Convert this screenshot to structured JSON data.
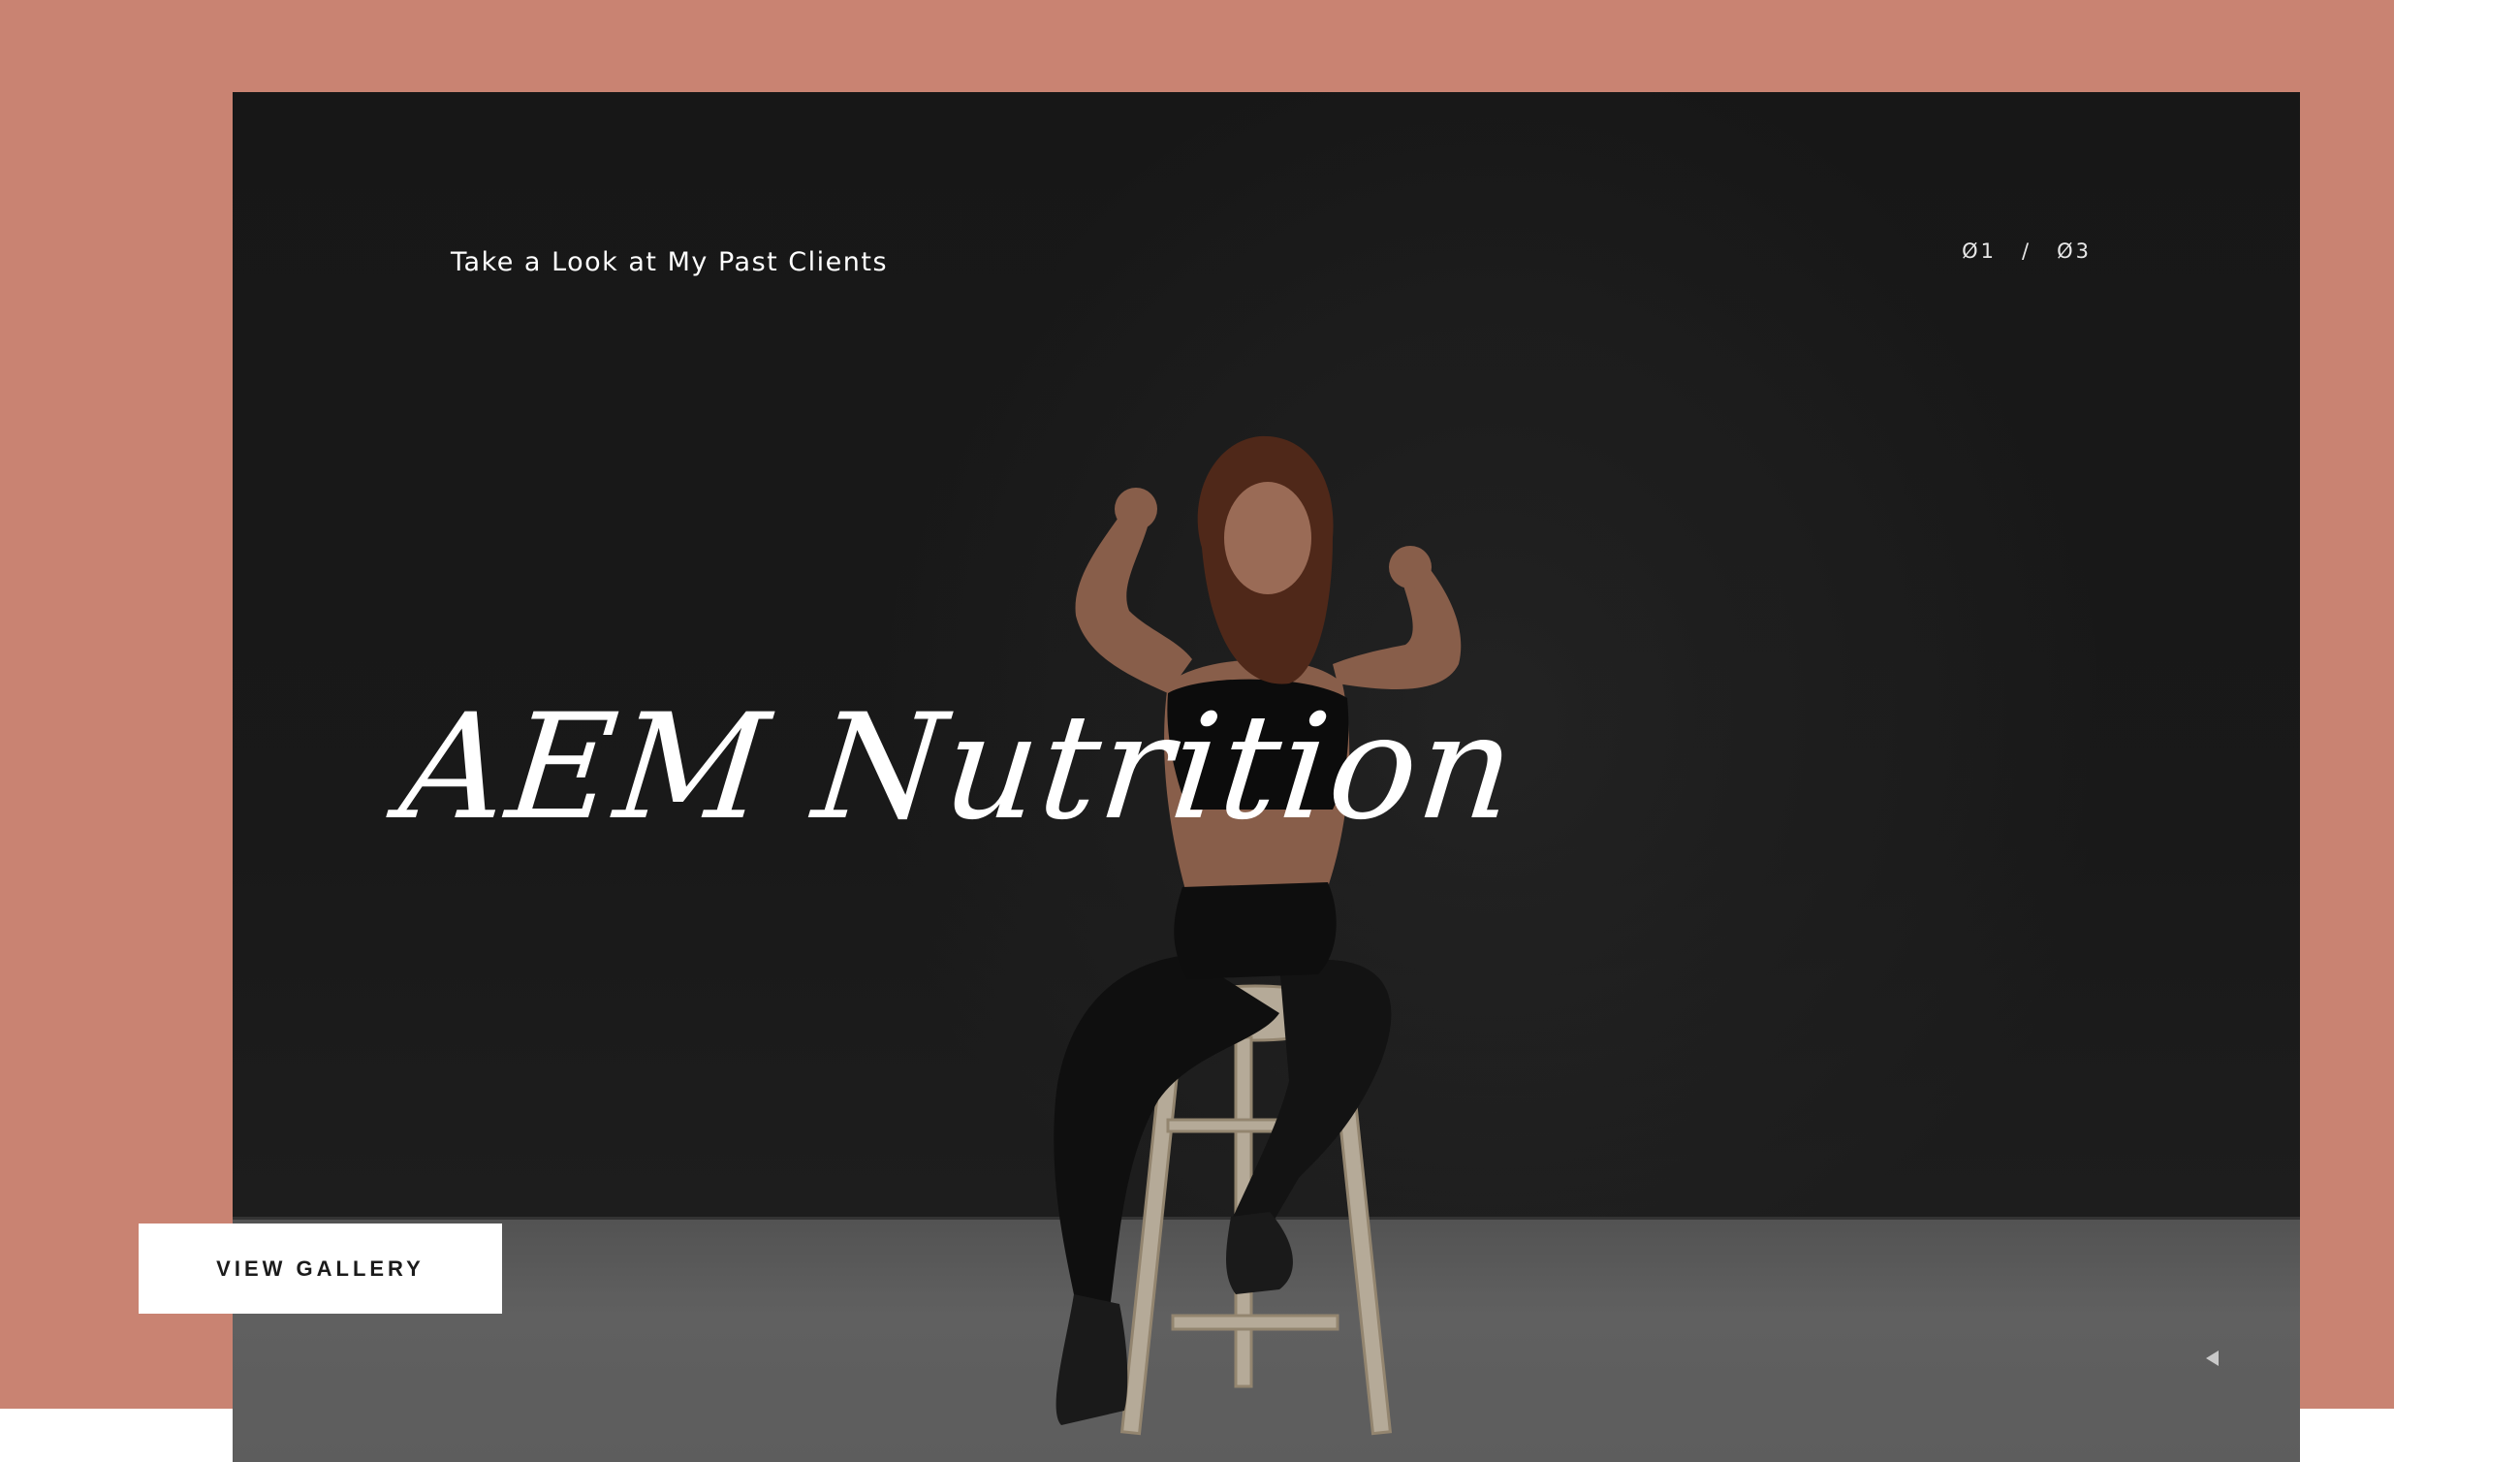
{
  "colors": {
    "accent_frame": "#c98372",
    "hero_background": "#1b1b1b",
    "text_light": "#ffffff",
    "button_bg": "#ffffff",
    "button_text": "#1b1b1b"
  },
  "hero": {
    "eyebrow": "Take a Look at My Past Clients",
    "title": "AEM Nutrition",
    "counter": {
      "current": "Ø1",
      "separator": "/",
      "total": "Ø3"
    },
    "image_description_icon": "client-photo"
  },
  "cta": {
    "label": "VIEW GALLERY"
  },
  "slider": {
    "prev_icon": "triangle-left-icon",
    "next_icon": "triangle-right-icon"
  }
}
